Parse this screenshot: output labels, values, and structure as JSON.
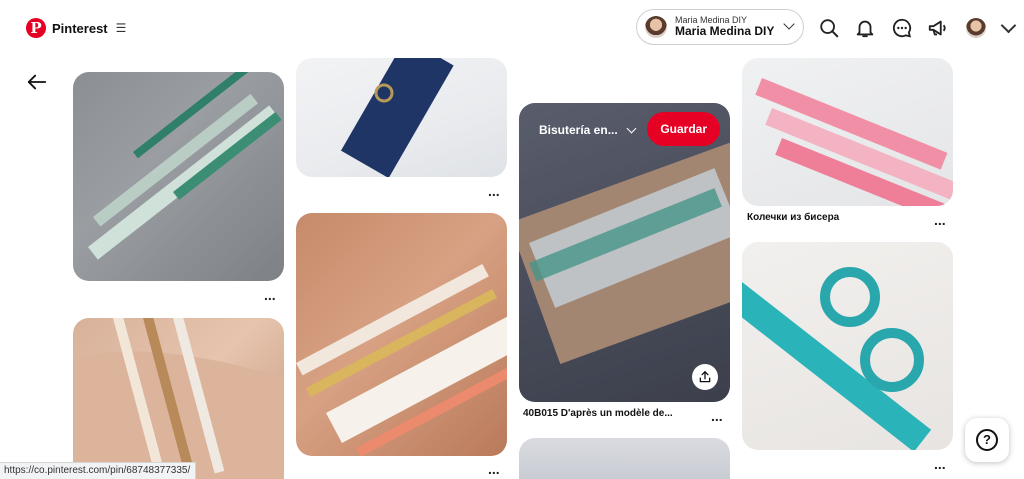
{
  "header": {
    "brand": "Pinterest",
    "account": {
      "name_small": "Maria Medina DIY",
      "name_bold": "Maria Medina DIY"
    }
  },
  "pins": [
    {
      "id": "p1",
      "more": "..."
    },
    {
      "id": "p2",
      "more": "..."
    },
    {
      "id": "p3",
      "more": "..."
    },
    {
      "id": "p4",
      "board": "Bisutería en...",
      "save_label": "Guardar",
      "caption": "40B015 D'après un modèle de...",
      "more": "..."
    },
    {
      "id": "p5",
      "caption": "Колечки из бисера",
      "more": "..."
    },
    {
      "id": "p6",
      "more": "..."
    }
  ],
  "status_url": "https://co.pinterest.com/pin/68748377335/",
  "help_label": "?",
  "icons": [
    "pinterest-logo-icon",
    "menu-icon",
    "search-icon",
    "bell-icon",
    "messages-icon",
    "megaphone-icon",
    "chevron-down-icon",
    "back-arrow-icon",
    "share-icon",
    "help-icon"
  ],
  "colors": {
    "accent": "#e60023"
  }
}
